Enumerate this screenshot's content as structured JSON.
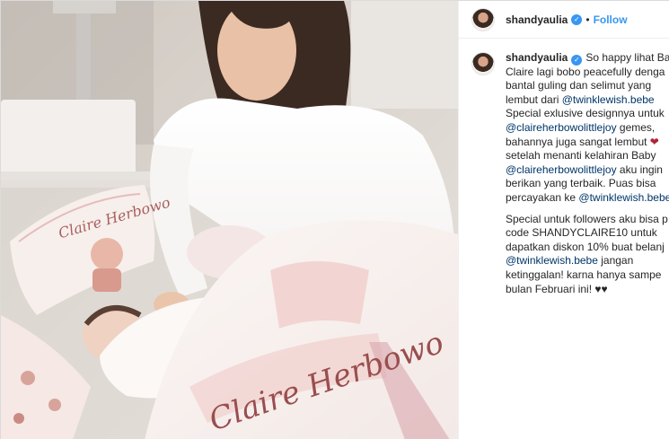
{
  "author": {
    "username": "shandyaulia",
    "verified_glyph": "✓",
    "separator": "•",
    "follow_label": "Follow"
  },
  "photo": {
    "pillow_text": "Claire Herbowo",
    "blanket_text": "Claire Herbowo"
  },
  "caption": {
    "username": "shandyaulia",
    "verified_glyph": "✓",
    "lines": [
      {
        "pre": "So happy lihat Ba",
        "link": "",
        "post": "",
        "first": true
      },
      {
        "pre": "Claire lagi bobo peacefully denga",
        "link": "",
        "post": ""
      },
      {
        "pre": "bantal guling dan selimut yang",
        "link": "",
        "post": ""
      },
      {
        "pre": "lembut dari ",
        "link": "@twinklewish.bebe",
        "post": ""
      },
      {
        "pre": "Special exlusive designnya untuk",
        "link": "",
        "post": ""
      },
      {
        "pre": "",
        "link": "@claireherbowolittlejoy",
        "post": " gemes,"
      },
      {
        "pre": "bahannya juga sangat lembut ",
        "link": "",
        "post": "",
        "heart": "❤"
      },
      {
        "pre": "setelah menanti kelahiran Baby",
        "link": "",
        "post": ""
      },
      {
        "pre": "",
        "link": "@claireherbowolittlejoy",
        "post": " aku ingin"
      },
      {
        "pre": "berikan yang terbaik. Puas bisa",
        "link": "",
        "post": ""
      },
      {
        "pre": "percayakan ke ",
        "link": "@twinklewish.bebe",
        "post": ""
      },
      {
        "pre": "Special untuk followers aku bisa p",
        "link": "",
        "post": "",
        "gap": true
      },
      {
        "pre": "code SHANDYCLAIRE10 untuk",
        "link": "",
        "post": ""
      },
      {
        "pre": "dapatkan diskon 10% buat belanj",
        "link": "",
        "post": ""
      },
      {
        "pre": "",
        "link": "@twinklewish.bebe",
        "post": " jangan"
      },
      {
        "pre": "ketinggalan! karna hanya sampe",
        "link": "",
        "post": ""
      },
      {
        "pre": "bulan Februari ini! ♥♥",
        "link": "",
        "post": ""
      }
    ]
  },
  "colors": {
    "accent": "#3897f0",
    "link": "#003569",
    "text": "#262626",
    "border": "#efefef"
  }
}
